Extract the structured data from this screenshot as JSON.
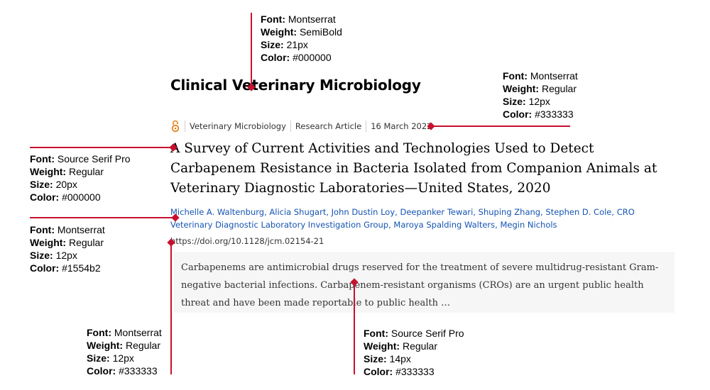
{
  "specs": {
    "journal_title": {
      "font": "Montserrat",
      "weight": "SemiBold",
      "size": "21px",
      "color": "#000000"
    },
    "meta": {
      "font": "Montserrat",
      "weight": "Regular",
      "size": "12px",
      "color": "#333333"
    },
    "article_title": {
      "font": "Source Serif Pro",
      "weight": "Regular",
      "size": "20px",
      "color": "#000000"
    },
    "authors": {
      "font": "Montserrat",
      "weight": "Regular",
      "size": "12px",
      "color": "#1554b2"
    },
    "doi": {
      "font": "Montserrat",
      "weight": "Regular",
      "size": "12px",
      "color": "#333333"
    },
    "abstract": {
      "font": "Source Serif Pro",
      "weight": "Regular",
      "size": "14px",
      "color": "#333333"
    }
  },
  "labels": {
    "font": "Font:",
    "weight": "Weight:",
    "size": "Size:",
    "color": "Color:"
  },
  "article": {
    "journal": "Clinical Veterinary Microbiology",
    "meta": {
      "section": "Veterinary Microbiology",
      "type": "Research Article",
      "date": "16 March 2022"
    },
    "title": "A Survey of Current Activities and Technologies Used to Detect Carbapenem Resistance in Bacteria Isolated from Companion Animals at Veterinary Diagnostic Laboratories—United States, 2020",
    "authors": [
      "Michelle A. Waltenburg",
      "Alicia Shugart",
      "John Dustin Loy",
      "Deepanker Tewari",
      "Shuping Zhang",
      "Stephen D. Cole",
      "CRO Veterinary Diagnostic Laboratory Investigation Group",
      "Maroya Spalding Walters",
      "Megin Nichols"
    ],
    "doi": "https://doi.org/10.1128/jcm.02154-21",
    "abstract": "Carbapenems are antimicrobial drugs reserved for the treatment of severe multidrug-resistant Gram-negative bacterial infections. Carbapenem-resistant organisms (CROs) are an urgent public health threat and have been made reportable to public health …"
  },
  "colors": {
    "annotation_line": "#c8102e",
    "link": "#1554b2",
    "abstract_bg": "#f6f6f6",
    "open_access": "#e8821e"
  }
}
